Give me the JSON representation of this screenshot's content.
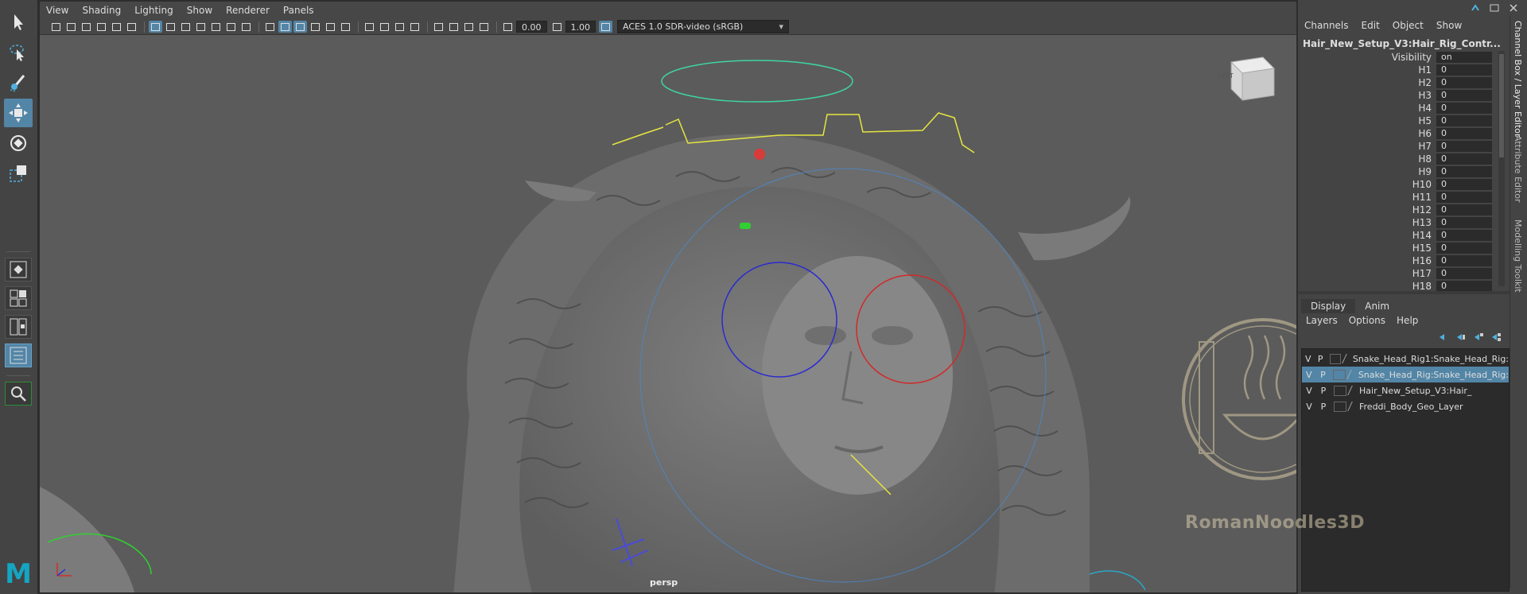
{
  "viewport": {
    "menu": [
      "View",
      "Shading",
      "Lighting",
      "Show",
      "Renderer",
      "Panels"
    ],
    "exposure": "0.00",
    "gamma": "1.00",
    "color_space": "ACES 1.0 SDR-video (sRGB)",
    "camera": "persp",
    "view_cube": "LEFT"
  },
  "channel_box": {
    "menu": [
      "Channels",
      "Edit",
      "Object",
      "Show"
    ],
    "node": "Hair_New_Setup_V3:Hair_Rig_Contr...",
    "attributes": [
      {
        "name": "Visibility",
        "value": "on"
      },
      {
        "name": "H1",
        "value": "0"
      },
      {
        "name": "H2",
        "value": "0"
      },
      {
        "name": "H3",
        "value": "0"
      },
      {
        "name": "H4",
        "value": "0"
      },
      {
        "name": "H5",
        "value": "0"
      },
      {
        "name": "H6",
        "value": "0"
      },
      {
        "name": "H7",
        "value": "0"
      },
      {
        "name": "H8",
        "value": "0"
      },
      {
        "name": "H9",
        "value": "0"
      },
      {
        "name": "H10",
        "value": "0"
      },
      {
        "name": "H11",
        "value": "0"
      },
      {
        "name": "H12",
        "value": "0"
      },
      {
        "name": "H13",
        "value": "0"
      },
      {
        "name": "H14",
        "value": "0"
      },
      {
        "name": "H15",
        "value": "0"
      },
      {
        "name": "H16",
        "value": "0"
      },
      {
        "name": "H17",
        "value": "0"
      },
      {
        "name": "H18",
        "value": "0"
      }
    ]
  },
  "side_tabs": [
    "Channel Box / Layer Editor",
    "Attribute Editor",
    "Modelling Toolkit"
  ],
  "layer_editor": {
    "tabs": [
      "Display",
      "Anim"
    ],
    "menu": [
      "Layers",
      "Options",
      "Help"
    ],
    "layers": [
      {
        "v": "V",
        "p": "P",
        "name": "Snake_Head_Rig1:Snake_Head_Rig:",
        "selected": false
      },
      {
        "v": "V",
        "p": "P",
        "name": "Snake_Head_Rig:Snake_Head_Rig:",
        "selected": true
      },
      {
        "v": "V",
        "p": "P",
        "name": "Hair_New_Setup_V3:Hair_",
        "selected": false
      },
      {
        "v": "V",
        "p": "P",
        "name": "Freddi_Body_Geo_Layer",
        "selected": false
      }
    ]
  },
  "watermark": "RomanNoodles3D",
  "app_logo": "M",
  "colors": {
    "accent": "#5285a6",
    "maya_teal": "#15a5c3",
    "curve_yellow": "#e6e640",
    "ctrl_blue": "#2a2ad0",
    "ctrl_red": "#d02a2a"
  }
}
